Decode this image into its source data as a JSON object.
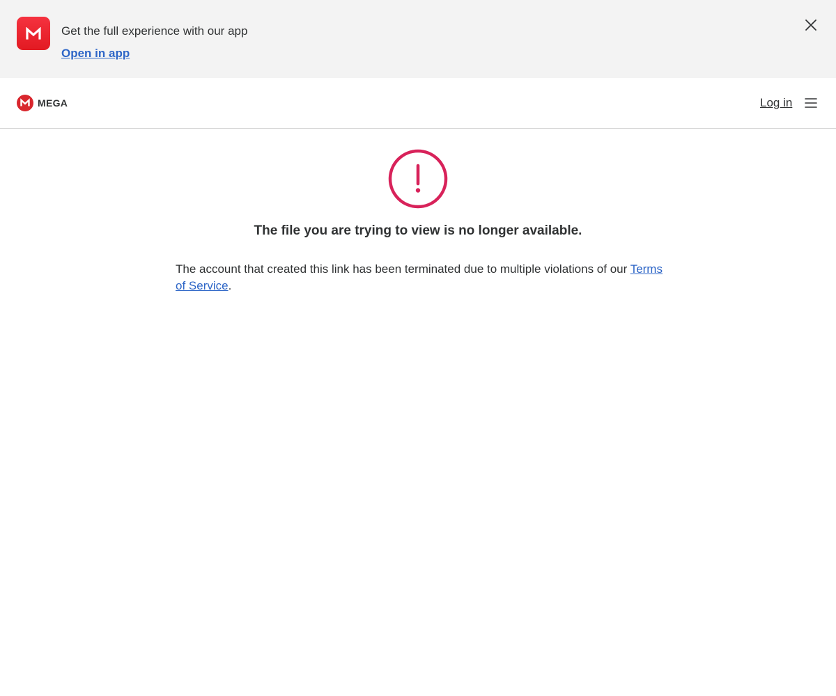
{
  "app_banner": {
    "app_icon_letter": "M",
    "text": "Get the full experience with our app",
    "open_link": "Open in app",
    "close_icon": "close-icon"
  },
  "top_bar": {
    "logo_text": "MEGA",
    "login_label": "Log in",
    "menu_icon": "hamburger-menu-icon"
  },
  "main": {
    "icon": "exclamation-circle-icon",
    "title": "The file you are trying to view is no longer available.",
    "description_prefix": "The account that created this link has been terminated due to multiple violations of our ",
    "terms_link": "Terms of Service",
    "description_suffix": "."
  },
  "colors": {
    "brand_red": "#e21a22",
    "warning_pink": "#d8225a",
    "link_blue": "#2e66c7",
    "banner_bg": "#f3f3f3",
    "text": "#303233"
  }
}
